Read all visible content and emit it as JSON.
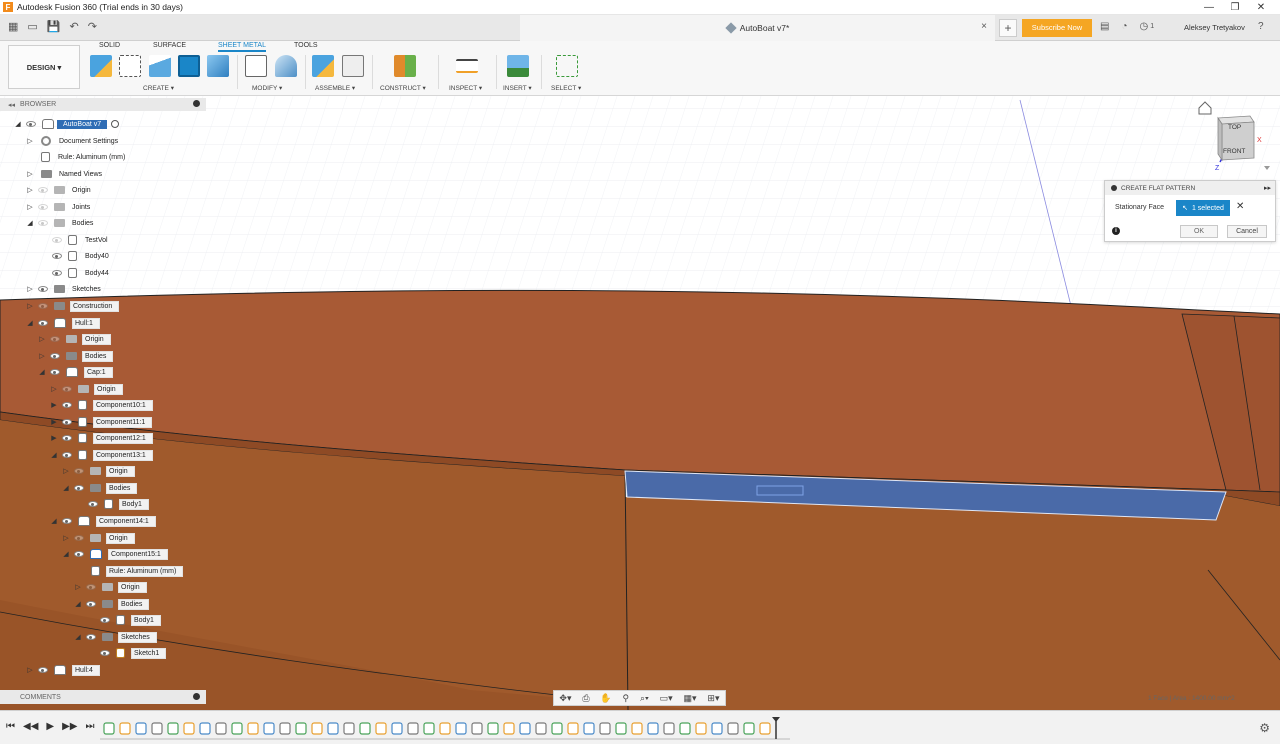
{
  "window": {
    "title": "Autodesk Fusion 360 (Trial ends in 30 days)",
    "controls": [
      "—",
      "❐",
      "✕"
    ]
  },
  "quickbar": {
    "doc_title": "AutoBoat v7*",
    "close": "×",
    "plus": "+",
    "subscribe": "Subscribe Now",
    "notifications": "1",
    "user": "Aleksey Tretyakov",
    "help": "?"
  },
  "ribbon": {
    "workspace": "DESIGN ▾",
    "tabs": [
      "SOLID",
      "SURFACE",
      "SHEET METAL",
      "TOOLS"
    ],
    "active_tab": "SHEET METAL",
    "groups": [
      "CREATE ▾",
      "MODIFY ▾",
      "ASSEMBLE ▾",
      "CONSTRUCT ▾",
      "INSPECT ▾",
      "INSERT ▾",
      "SELECT ▾"
    ]
  },
  "browser": {
    "header": "BROWSER",
    "items": [
      {
        "label": "AutoBoat v7",
        "kind": "root"
      },
      {
        "label": "Document Settings",
        "kind": "settings"
      },
      {
        "label": "Rule: Aluminum (mm)",
        "kind": "rule"
      },
      {
        "label": "Named Views",
        "kind": "folder"
      },
      {
        "label": "Origin",
        "kind": "folder"
      },
      {
        "label": "Joints",
        "kind": "folder"
      },
      {
        "label": "Bodies",
        "kind": "folder"
      },
      {
        "label": "TestVol",
        "kind": "body"
      },
      {
        "label": "Body40",
        "kind": "body"
      },
      {
        "label": "Body44",
        "kind": "body"
      },
      {
        "label": "Sketches",
        "kind": "folder"
      },
      {
        "label": "Construction",
        "kind": "folder"
      },
      {
        "label": "Hull:1",
        "kind": "component"
      },
      {
        "label": "Origin",
        "kind": "folder"
      },
      {
        "label": "Bodies",
        "kind": "folder"
      },
      {
        "label": "Cap:1",
        "kind": "component"
      },
      {
        "label": "Origin",
        "kind": "folder"
      },
      {
        "label": "Component10:1",
        "kind": "body"
      },
      {
        "label": "Component11:1",
        "kind": "body"
      },
      {
        "label": "Component12:1",
        "kind": "body"
      },
      {
        "label": "Component13:1",
        "kind": "body"
      },
      {
        "label": "Origin",
        "kind": "folder"
      },
      {
        "label": "Bodies",
        "kind": "folder"
      },
      {
        "label": "Body1",
        "kind": "body"
      },
      {
        "label": "Component14:1",
        "kind": "component"
      },
      {
        "label": "Origin",
        "kind": "folder"
      },
      {
        "label": "Component15:1",
        "kind": "component"
      },
      {
        "label": "Rule: Aluminum (mm)",
        "kind": "rule"
      },
      {
        "label": "Origin",
        "kind": "folder"
      },
      {
        "label": "Bodies",
        "kind": "folder"
      },
      {
        "label": "Body1",
        "kind": "body"
      },
      {
        "label": "Sketches",
        "kind": "folder"
      },
      {
        "label": "Sketch1",
        "kind": "sketch"
      },
      {
        "label": "Hull:4",
        "kind": "component"
      }
    ]
  },
  "dialog": {
    "title": "CREATE FLAT PATTERN",
    "field_label": "Stationary Face",
    "selection": "1 selected",
    "clear": "✕",
    "info": "i",
    "ok": "OK",
    "cancel": "Cancel"
  },
  "viewcube": {
    "top": "TOP",
    "front": "FRONT",
    "x": "X",
    "z": "Z"
  },
  "comments": {
    "label": "COMMENTS"
  },
  "status": "1 Face | Area : 1400.00 mm^2",
  "colors": {
    "accent": "#1a86c8",
    "hull": "#a85a35",
    "selected_face": "#4a6aa8",
    "subscribe": "#f5a623"
  }
}
